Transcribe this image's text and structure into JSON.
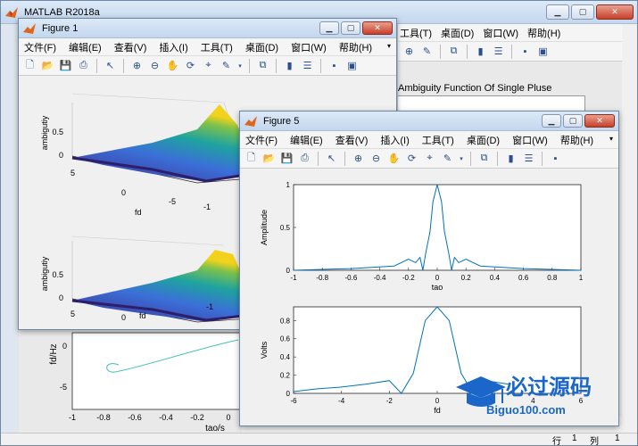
{
  "matlab": {
    "title": "MATLAB R2018a",
    "status_row_label": "行",
    "status_row_value": "1",
    "status_col_label": "列",
    "status_col_value": "1"
  },
  "menus": [
    "文件(F)",
    "编辑(E)",
    "查看(V)",
    "插入(I)",
    "工具(T)",
    "桌面(D)",
    "窗口(W)",
    "帮助(H)"
  ],
  "back_figure": {
    "title": "Ambiguity Function Of Single Pluse",
    "x_ticks": [
      "-1",
      "-0.8",
      "-0.6",
      "-0.4",
      "-0.2",
      "0"
    ],
    "y_ticks": [
      "0",
      "-5"
    ],
    "xlabel": "tao/s",
    "ylabel": "fd/Hz"
  },
  "figure1": {
    "title": "Figure 1",
    "zlabel": "ambigutiy",
    "xlabel": "fd",
    "z_ticks": [
      "0.5",
      "0"
    ],
    "fd_ticks": [
      "5",
      "0",
      "-5"
    ],
    "tau_ticks": [
      "-1"
    ]
  },
  "figure5": {
    "title": "Figure 5",
    "top_ylabel": "Amplitude",
    "top_xlabel": "tao",
    "bottom_ylabel": "Volts",
    "bottom_xlabel": "fd"
  },
  "chart_data": [
    {
      "type": "line",
      "title": "",
      "xlabel": "tao",
      "ylabel": "Amplitude",
      "xlim": [
        -1,
        1
      ],
      "ylim": [
        0,
        1
      ],
      "x_ticks": [
        -1,
        -0.8,
        -0.6,
        -0.4,
        -0.2,
        0,
        0.2,
        0.4,
        0.6,
        0.8,
        1
      ],
      "y_ticks": [
        0,
        0.5,
        1
      ],
      "grid": false,
      "color": "#0072bd",
      "x": [
        -1,
        -0.6,
        -0.3,
        -0.2,
        -0.15,
        -0.12,
        -0.1,
        -0.08,
        -0.05,
        -0.03,
        0,
        0.03,
        0.05,
        0.08,
        0.1,
        0.12,
        0.15,
        0.2,
        0.3,
        0.6,
        1
      ],
      "y": [
        0.0,
        0.02,
        0.05,
        0.13,
        0.09,
        0.15,
        0.0,
        0.2,
        0.45,
        0.8,
        1.0,
        0.8,
        0.45,
        0.2,
        0.0,
        0.15,
        0.09,
        0.13,
        0.05,
        0.02,
        0.0
      ]
    },
    {
      "type": "line",
      "title": "",
      "xlabel": "fd",
      "ylabel": "Volts",
      "xlim": [
        -6,
        6
      ],
      "ylim": [
        0,
        0.95
      ],
      "x_ticks": [
        -6,
        -4,
        -2,
        0,
        2,
        4,
        6
      ],
      "y_ticks": [
        0,
        0.2,
        0.4,
        0.6,
        0.8
      ],
      "grid": false,
      "color": "#0072bd",
      "x": [
        -6,
        -5,
        -4,
        -3,
        -2,
        -1.5,
        -1,
        -0.5,
        0,
        0.5,
        1,
        1.5,
        2,
        3
      ],
      "y": [
        0.02,
        0.05,
        0.07,
        0.1,
        0.14,
        0.0,
        0.22,
        0.8,
        0.95,
        0.8,
        0.22,
        0.0,
        0.14,
        0.1
      ]
    }
  ]
}
